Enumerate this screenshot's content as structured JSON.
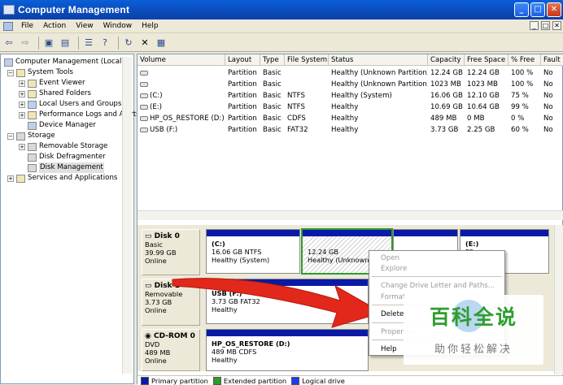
{
  "window": {
    "title": "Computer Management",
    "controls": {
      "minimize": "_",
      "maximize": "□",
      "close": "✕"
    }
  },
  "menubar": {
    "items": [
      "File",
      "Action",
      "View",
      "Window",
      "Help"
    ],
    "mdi_controls": [
      "_",
      "□",
      "✕"
    ]
  },
  "toolbar": {
    "buttons": [
      "back-icon",
      "forward-icon",
      "up-folder-icon",
      "show-tree-icon",
      "properties-icon",
      "help-icon",
      "refresh-icon",
      "delete-icon",
      "export-icon"
    ]
  },
  "tree": {
    "items": [
      {
        "label": "Computer Management (Local)",
        "level": 0,
        "expander": "",
        "icon": "computer-icon"
      },
      {
        "label": "System Tools",
        "level": 1,
        "expander": "−",
        "icon": "tools-icon"
      },
      {
        "label": "Event Viewer",
        "level": 2,
        "expander": "+",
        "icon": "event-viewer-icon"
      },
      {
        "label": "Shared Folders",
        "level": 2,
        "expander": "+",
        "icon": "shared-folders-icon"
      },
      {
        "label": "Local Users and Groups",
        "level": 2,
        "expander": "+",
        "icon": "users-icon"
      },
      {
        "label": "Performance Logs and Alerts",
        "level": 2,
        "expander": "+",
        "icon": "performance-icon"
      },
      {
        "label": "Device Manager",
        "level": 2,
        "expander": "",
        "icon": "device-manager-icon"
      },
      {
        "label": "Storage",
        "level": 1,
        "expander": "−",
        "icon": "storage-icon"
      },
      {
        "label": "Removable Storage",
        "level": 2,
        "expander": "+",
        "icon": "removable-storage-icon"
      },
      {
        "label": "Disk Defragmenter",
        "level": 2,
        "expander": "",
        "icon": "defragmenter-icon"
      },
      {
        "label": "Disk Management",
        "level": 2,
        "expander": "",
        "icon": "disk-management-icon",
        "selected": true
      },
      {
        "label": "Services and Applications",
        "level": 1,
        "expander": "+",
        "icon": "services-icon"
      }
    ]
  },
  "volumes": {
    "columns": [
      "Volume",
      "Layout",
      "Type",
      "File System",
      "Status",
      "Capacity",
      "Free Space",
      "% Free",
      "Fault"
    ],
    "rows": [
      [
        "",
        "Partition",
        "Basic",
        "",
        "Healthy (Unknown Partition)",
        "12.24 GB",
        "12.24 GB",
        "100 %",
        "No"
      ],
      [
        "",
        "Partition",
        "Basic",
        "",
        "Healthy (Unknown Partition)",
        "1023 MB",
        "1023 MB",
        "100 %",
        "No"
      ],
      [
        "(C:)",
        "Partition",
        "Basic",
        "NTFS",
        "Healthy (System)",
        "16.06 GB",
        "12.10 GB",
        "75 %",
        "No"
      ],
      [
        "(E:)",
        "Partition",
        "Basic",
        "NTFS",
        "Healthy",
        "10.69 GB",
        "10.64 GB",
        "99 %",
        "No"
      ],
      [
        "HP_OS_RESTORE (D:)",
        "Partition",
        "Basic",
        "CDFS",
        "Healthy",
        "489 MB",
        "0 MB",
        "0 %",
        "No"
      ],
      [
        "USB (F:)",
        "Partition",
        "Basic",
        "FAT32",
        "Healthy",
        "3.73 GB",
        "2.25 GB",
        "60 %",
        "No"
      ]
    ]
  },
  "disks": [
    {
      "name": "Disk 0",
      "type": "Basic",
      "size": "39.99 GB",
      "status": "Online"
    },
    {
      "name": "Disk 1",
      "type": "Removable",
      "size": "3.73 GB",
      "status": "Online"
    },
    {
      "name": "CD-ROM 0",
      "type": "DVD",
      "size": "489 MB",
      "status": "Online"
    }
  ],
  "partitions": {
    "c": {
      "name": "(C:)",
      "detail": "16.06 GB NTFS",
      "status": "Healthy (System)"
    },
    "unknown": {
      "name": "",
      "detail": "12.24 GB",
      "status": "Healthy (Unknown"
    },
    "e": {
      "name": "(E:)",
      "detail": "FS",
      "status": ""
    },
    "usb": {
      "name": "USB  (F:)",
      "detail": "3.73 GB FAT32",
      "status": "Healthy"
    },
    "restore": {
      "name": "HP_OS_RESTORE  (D:)",
      "detail": "489 MB CDFS",
      "status": "Healthy"
    }
  },
  "context_menu": {
    "open": "Open",
    "explore": "Explore",
    "change_letter": "Change Drive Letter and Paths...",
    "format": "Format...",
    "delete": "Delete",
    "properties": "Properties",
    "help": "Help"
  },
  "legend": {
    "primary": "Primary partition",
    "extended": "Extended partition",
    "logical": "Logical drive"
  },
  "colors": {
    "primary": "#0a1aa6",
    "extended": "#2e9b2e",
    "logical": "#1c3cf0",
    "arrow": "#e2271b"
  },
  "watermark": {
    "title": "百科全说",
    "subtitle": "助你轻松解决"
  }
}
